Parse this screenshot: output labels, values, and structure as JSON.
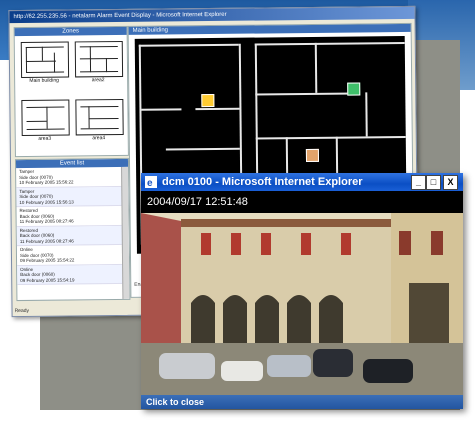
{
  "back_window": {
    "title": "http://62.255.235.56 - netalarm Alarm Event Display - Microsoft Internet Explorer",
    "zones_header": "Zones",
    "main_header": "Main building",
    "zones": [
      {
        "label": "Main building"
      },
      {
        "label": "area2"
      },
      {
        "label": "area3"
      },
      {
        "label": "area4"
      }
    ],
    "events_header": "Event list",
    "events": [
      {
        "title": "Tamper",
        "detail": "Side door (0070)",
        "time": "10 February 2005 15:56:22"
      },
      {
        "title": "Tamper",
        "detail": "Side door (0070)",
        "time": "10 February 2005 15:56:13"
      },
      {
        "title": "Restored",
        "detail": "Back door (0060)",
        "time": "11 February 2005 08:27:46"
      },
      {
        "title": "Restored",
        "detail": "Back door (0060)",
        "time": "11 February 2005 08:27:46"
      },
      {
        "title": "Online",
        "detail": "Side door (0070)",
        "time": "09 February 2005 15:54:22"
      },
      {
        "title": "Online",
        "detail": "Back door (0060)",
        "time": "09 February 2005 15:54:19"
      }
    ],
    "enable_label": "Enable",
    "status": "Ready"
  },
  "front_window": {
    "title": "dcm 0100 - Microsoft Internet Explorer",
    "timestamp": "2004/09/17 12:51:48",
    "close_label": "Click to close",
    "buttons": {
      "minimize": "_",
      "maximize": "□",
      "close": "X"
    }
  }
}
